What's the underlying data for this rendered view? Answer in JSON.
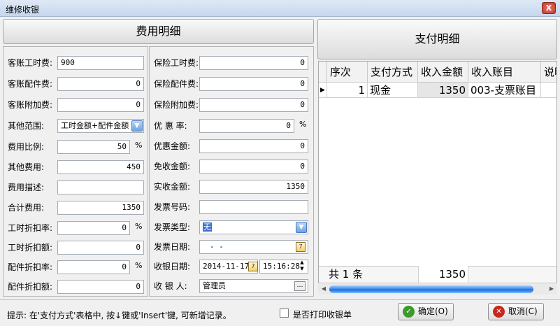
{
  "window": {
    "title": "维修收银",
    "close_glyph": "X"
  },
  "fee_panel": {
    "title": "费用明细",
    "left": [
      {
        "label": "客账工时费:",
        "value": "900"
      },
      {
        "label": "客账配件费:",
        "value": "0"
      },
      {
        "label": "客账附加费:",
        "value": "0"
      },
      {
        "label": "其他范围:",
        "value": "工时金额+配件金额"
      },
      {
        "label": "费用比例:",
        "value": "50",
        "unit": "%"
      },
      {
        "label": "其他费用:",
        "value": "450"
      },
      {
        "label": "费用描述:",
        "value": ""
      },
      {
        "label": "合计费用:",
        "value": "1350"
      },
      {
        "label": "工时折扣率:",
        "value": "0",
        "unit": "%"
      },
      {
        "label": "工时折扣额:",
        "value": "0"
      },
      {
        "label": "配件折扣率:",
        "value": "0",
        "unit": "%"
      },
      {
        "label": "配件折扣额:",
        "value": "0"
      }
    ],
    "right": [
      {
        "label": "保险工时费:",
        "value": "0"
      },
      {
        "label": "保险配件费:",
        "value": "0"
      },
      {
        "label": "保险附加费:",
        "value": "0"
      },
      {
        "label": "优 惠 率:",
        "value": "0",
        "unit": "%"
      },
      {
        "label": "优惠金额:",
        "value": "0"
      },
      {
        "label": "免收金额:",
        "value": "0"
      },
      {
        "label": "实收金额:",
        "value": "1350"
      },
      {
        "label": "发票号码:",
        "value": ""
      },
      {
        "label": "发票类型:",
        "value": "无"
      },
      {
        "label": "发票日期:",
        "value": "- -"
      },
      {
        "label": "收银日期:",
        "date": "2014-11-17",
        "time": "15:16:28"
      },
      {
        "label": "收 银 人:",
        "value": "管理员"
      }
    ]
  },
  "payment_panel": {
    "title": "支付明细",
    "columns": [
      "序次",
      "支付方式",
      "收入金额",
      "收入账目",
      "说明"
    ],
    "rows": [
      {
        "seq": "1",
        "method": "现金",
        "amount": "1350",
        "account": "003-支票账目"
      }
    ],
    "footer": {
      "count_text": "共 1 条",
      "total": "1350"
    }
  },
  "status": {
    "hint": "提示: 在'支付方式'表格中, 按↓键或'Insert'键, 可新增记录。",
    "print_checkbox_label": "是否打印收银单",
    "ok_label": "确定(O)",
    "cancel_label": "取消(C)"
  },
  "colors": {
    "ok": "#3a9a2a",
    "cancel": "#c8281c",
    "selection": "#3b6fd1"
  }
}
